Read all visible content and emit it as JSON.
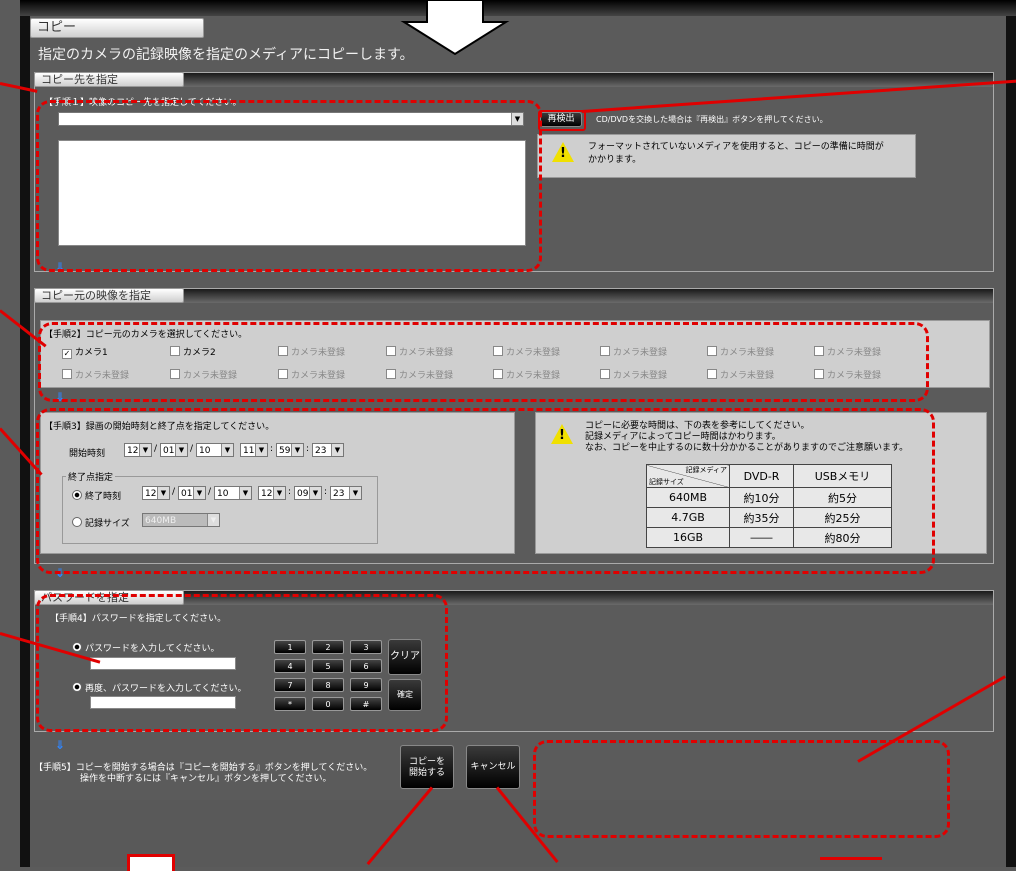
{
  "header": {
    "tab_label": "コピー",
    "subtitle": "指定のカメラの記録映像を指定のメディアにコピーします。"
  },
  "dest": {
    "section_label": "コピー先を指定",
    "step1": "【手順１】映像のコピー先を指定してください。",
    "redetect_label": "再検出",
    "redetect_hint": "CD/DVDを交換した場合は『再検出』ボタンを押してください。",
    "warning": "フォーマットされていないメディアを使用すると、コピーの準備に時間がかかります。"
  },
  "source": {
    "section_label": "コピー元の映像を指定",
    "step2": "【手順2】コピー元のカメラを選択してください。",
    "cameras_row1": [
      "カメラ1",
      "カメラ2",
      "カメラ未登録",
      "カメラ未登録",
      "カメラ未登録",
      "カメラ未登録",
      "カメラ未登録",
      "カメラ未登録"
    ],
    "cameras_row2": [
      "カメラ未登録",
      "カメラ未登録",
      "カメラ未登録",
      "カメラ未登録",
      "カメラ未登録",
      "カメラ未登録",
      "カメラ未登録",
      "カメラ未登録"
    ],
    "step3": "【手順3】録画の開始時刻と終了点を指定してください。",
    "start_label": "開始時刻",
    "start": {
      "year": "12",
      "month": "01",
      "day": "10",
      "hour": "11",
      "min": "59",
      "sec": "23"
    },
    "end_group_label": "終了点指定",
    "end_time_label": "終了時刻",
    "end": {
      "year": "12",
      "month": "01",
      "day": "10",
      "hour": "12",
      "min": "09",
      "sec": "23"
    },
    "size_label": "記録サイズ",
    "size_value": "640MB",
    "info_line1": "コピーに必要な時間は、下の表を参考にしてください。",
    "info_line2": "記録メディアによってコピー時間はかわります。",
    "info_line3": "なお、コピーを中止するのに数十分かかることがありますのでご注意願います。",
    "table": {
      "corner_top": "記録メディア",
      "corner_bottom": "記録サイズ",
      "columns": [
        "DVD-R",
        "USBメモリ"
      ],
      "rows": [
        {
          "size": "640MB",
          "dvd": "約10分",
          "usb": "約5分"
        },
        {
          "size": "4.7GB",
          "dvd": "約35分",
          "usb": "約25分"
        },
        {
          "size": "16GB",
          "dvd": "――",
          "usb": "約80分"
        }
      ]
    }
  },
  "password": {
    "section_label": "パスワードを指定",
    "step4": "【手順4】パスワードを指定してください。",
    "enter_label": "パスワードを入力してください。",
    "reenter_label": "再度、パスワードを入力してください。",
    "keys": [
      "1",
      "2",
      "3",
      "4",
      "5",
      "6",
      "7",
      "8",
      "9",
      "*",
      "0",
      "#"
    ],
    "clear_label": "クリア",
    "confirm_label": "確定"
  },
  "footer": {
    "step5_line1": "【手順5】コピーを開始する場合は『コピーを開始する』ボタンを押してください。",
    "step5_line2": "操作を中断するには『キャンセル』ボタンを押してください。",
    "start_copy_line1": "コピーを",
    "start_copy_line2": "開始する",
    "cancel_label": "キャンセル"
  },
  "colors": {
    "annotation": "#e00000",
    "background": "#5b5b5b",
    "arrow": "#2f86ff"
  }
}
